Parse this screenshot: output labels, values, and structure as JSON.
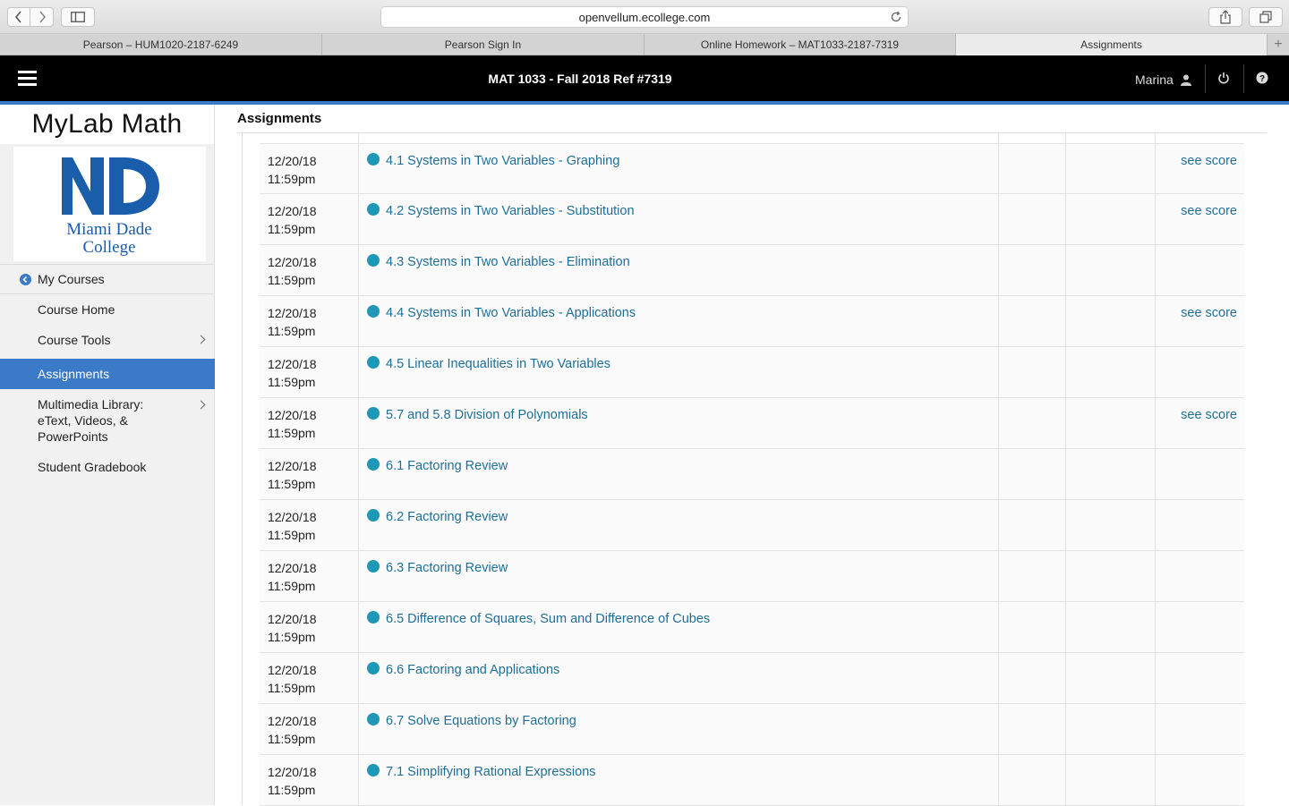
{
  "browser": {
    "url": "openvellum.ecollege.com",
    "tabs": [
      {
        "label": "Pearson – HUM1020-2187-6249"
      },
      {
        "label": "Pearson Sign In"
      },
      {
        "label": "Online Homework – MAT1033-2187-7319"
      },
      {
        "label": "Assignments"
      }
    ]
  },
  "header": {
    "course_title": "MAT 1033 - Fall 2018 Ref #7319",
    "user_name": "Marina"
  },
  "sidebar": {
    "brand": "MyLab Math",
    "logo_line1": "Miami Dade",
    "logo_line2": "College",
    "my_courses": "My Courses",
    "items": [
      {
        "label": "Course Home"
      },
      {
        "label": "Course Tools"
      },
      {
        "label": "Assignments"
      },
      {
        "label": "Multimedia Library: eText, Videos, & PowerPoints"
      },
      {
        "label": "Student Gradebook"
      }
    ]
  },
  "main": {
    "title": "Assignments",
    "rows": [
      {
        "date": "12/20/18",
        "time": "11:59pm",
        "name": "4.1 Systems in Two Variables - Graphing",
        "score": "see score"
      },
      {
        "date": "12/20/18",
        "time": "11:59pm",
        "name": "4.2 Systems in Two Variables - Substitution",
        "score": "see score"
      },
      {
        "date": "12/20/18",
        "time": "11:59pm",
        "name": "4.3 Systems in Two Variables - Elimination",
        "score": ""
      },
      {
        "date": "12/20/18",
        "time": "11:59pm",
        "name": "4.4 Systems in Two Variables - Applications",
        "score": "see score"
      },
      {
        "date": "12/20/18",
        "time": "11:59pm",
        "name": "4.5 Linear Inequalities in Two Variables",
        "score": ""
      },
      {
        "date": "12/20/18",
        "time": "11:59pm",
        "name": "5.7 and 5.8 Division of Polynomials",
        "score": "see score"
      },
      {
        "date": "12/20/18",
        "time": "11:59pm",
        "name": "6.1 Factoring Review",
        "score": ""
      },
      {
        "date": "12/20/18",
        "time": "11:59pm",
        "name": "6.2 Factoring Review",
        "score": ""
      },
      {
        "date": "12/20/18",
        "time": "11:59pm",
        "name": "6.3 Factoring Review",
        "score": ""
      },
      {
        "date": "12/20/18",
        "time": "11:59pm",
        "name": "6.5 Difference of Squares, Sum and Difference of Cubes",
        "score": ""
      },
      {
        "date": "12/20/18",
        "time": "11:59pm",
        "name": "6.6 Factoring and Applications",
        "score": ""
      },
      {
        "date": "12/20/18",
        "time": "11:59pm",
        "name": "6.7 Solve Equations by Factoring",
        "score": ""
      },
      {
        "date": "12/20/18",
        "time": "11:59pm",
        "name": "7.1 Simplifying Rational Expressions",
        "score": ""
      }
    ]
  },
  "colors": {
    "accent": "#3a7ac6",
    "link": "#1e6e97",
    "status_dot": "#1f97b7",
    "logo": "#1a5dab"
  }
}
